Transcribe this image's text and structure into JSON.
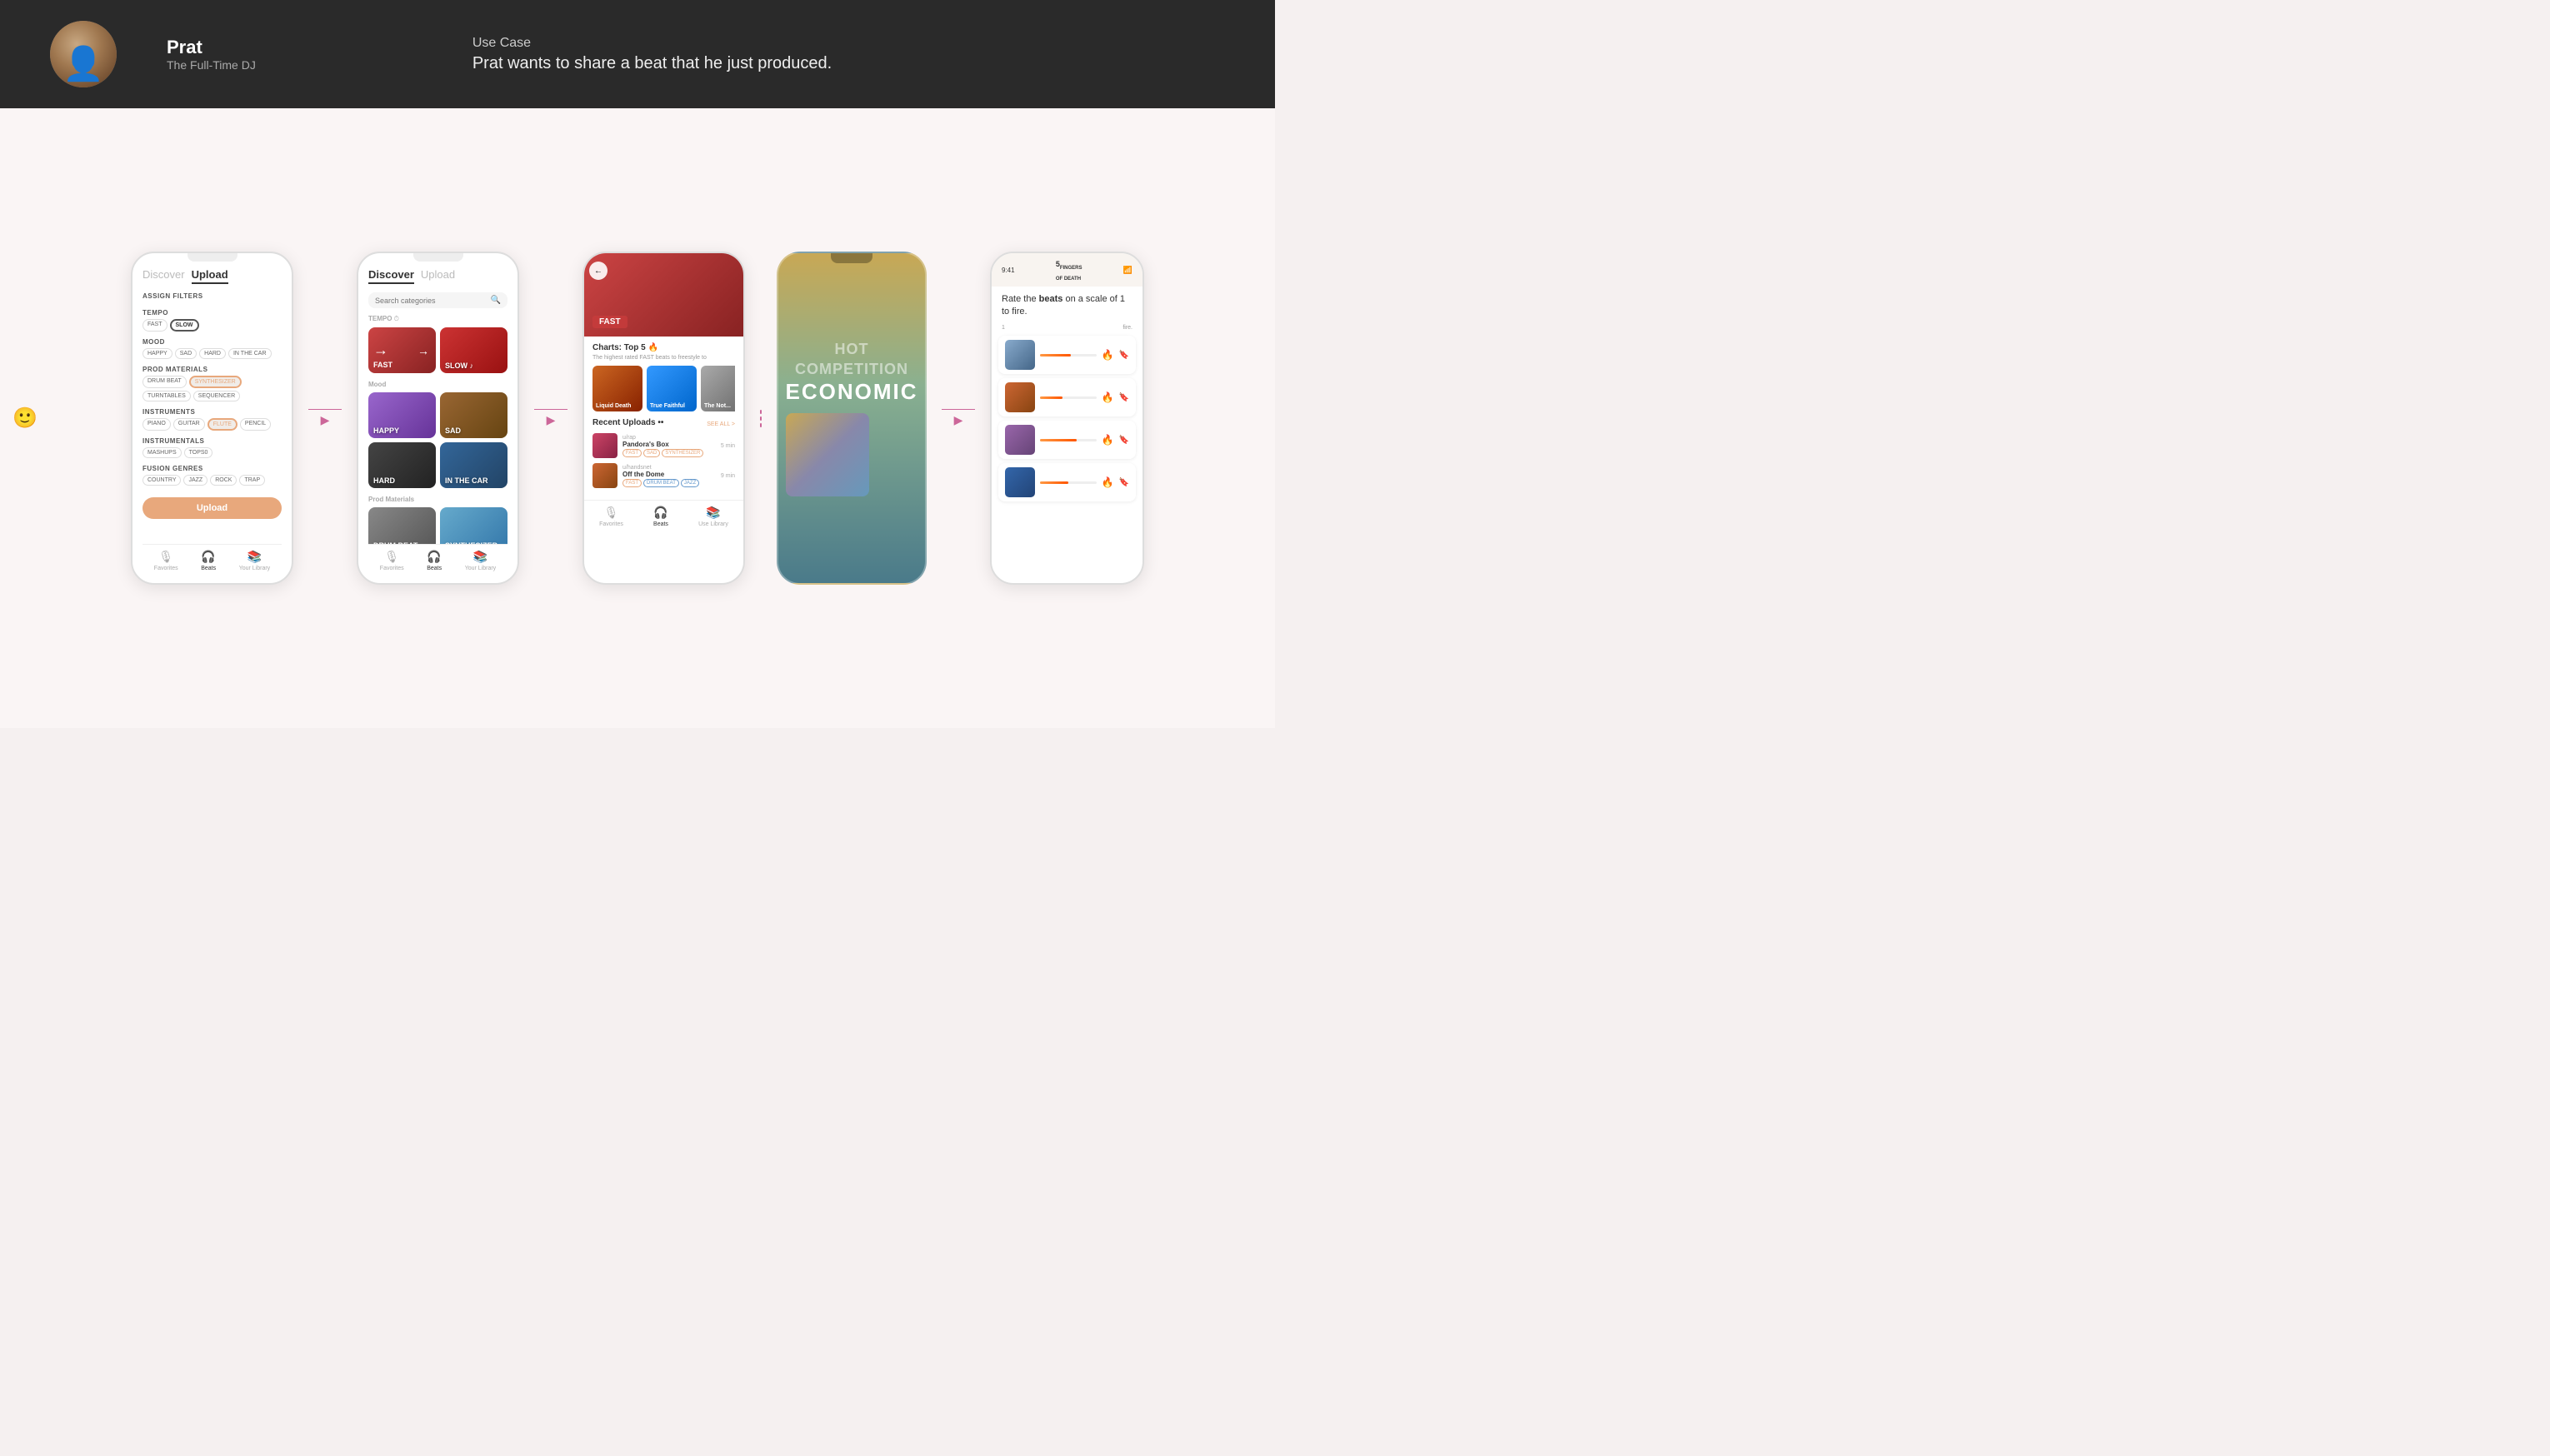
{
  "header": {
    "user_name": "Prat",
    "user_title": "The Full-Time DJ",
    "use_case_label": "Use Case",
    "use_case_desc": "Prat wants to share a beat that he just produced."
  },
  "phone1": {
    "tab_discover": "Discover",
    "tab_upload": "Upload",
    "section_filters": "ASSIGN FILTERS",
    "tempo_label": "Tempo",
    "tempo_tags": [
      "FAST",
      "SLOW"
    ],
    "mood_label": "Mood",
    "mood_tags": [
      "HAPPY",
      "SAD",
      "HARD",
      "IN THE CAR"
    ],
    "prod_label": "Prod Materials",
    "prod_tags": [
      "DRUM BEAT",
      "SYNTHESIZER"
    ],
    "prod_tags2": [
      "TURNTABLES",
      "SEQUENCER"
    ],
    "instruments_label": "Instruments",
    "instruments_tags": [
      "PIANO",
      "GUITAR",
      "FLUTE",
      "PENCIL"
    ],
    "instrumentals_label": "Instrumentals",
    "instrumentals_tags": [
      "MASHUPS",
      "TOPS0"
    ],
    "fusion_label": "Fusion Genres",
    "fusion_tags": [
      "COUNTRY",
      "JAZZ",
      "ROCK",
      "TRAP"
    ],
    "upload_btn": "Upload",
    "tab_favorites": "Favorites",
    "tab_beats": "Beats",
    "tab_library": "Your Library"
  },
  "phone2": {
    "tab_discover": "Discover",
    "tab_upload": "Upload",
    "search_placeholder": "Search categories",
    "tempo_label": "TEMPO",
    "mood_label": "Mood",
    "prod_label": "Prod Materials",
    "categories": [
      {
        "label": "FAST",
        "style": "fast"
      },
      {
        "label": "SLOW ♪",
        "style": "slow"
      },
      {
        "label": "HAPPY",
        "style": "happy"
      },
      {
        "label": "SAD",
        "style": "sad"
      },
      {
        "label": "HARD",
        "style": "hard"
      },
      {
        "label": "IN THE CAR",
        "style": "inthecar"
      },
      {
        "label": "DRUM BEAT",
        "style": "drumbeat"
      },
      {
        "label": "SYNTHESIZER",
        "style": "synth"
      }
    ],
    "tab_favorites": "Favorites",
    "tab_beats": "Beats",
    "tab_library": "Your Library"
  },
  "phone3": {
    "hero_label": "FAST",
    "charts_title": "Charts: Top 5 🔥",
    "charts_subtitle": "The highest rated FAST beats to freestyle to",
    "mood_cards": [
      {
        "label": "Liquid Death",
        "style": "liq"
      },
      {
        "label": "True Faithful",
        "style": "tru"
      },
      {
        "label": "The Not...",
        "style": "not"
      }
    ],
    "recent_title": "Recent Uploads ••",
    "see_all": "SEE ALL >",
    "uploads": [
      {
        "user": "u/rap",
        "title": "Pandora's Box",
        "tags": [
          "FAST",
          "SAD",
          "SYNTHESIZER"
        ],
        "time": "5 min"
      },
      {
        "user": "u/handsnet",
        "title": "Off the Dome",
        "tags": [
          "FAST",
          "DRUM BEAT",
          "JAZZ"
        ],
        "time": "9 min"
      }
    ],
    "tab_favorites": "Favorites",
    "tab_beats": "Beats",
    "tab_library": "Use Library"
  },
  "phone4": {
    "hot_text": "HOT",
    "competition_text": "COMPETITION",
    "economic_text": "ECONOMIC"
  },
  "phone5": {
    "status_bar": "9:41",
    "logo": "5 FINGERS OF DEATH",
    "rate_text": "Rate the beats on a scale of 1 to fire.",
    "scale_low": "1",
    "scale_high": "fire.",
    "items": [
      {
        "fill": 55
      },
      {
        "fill": 40
      },
      {
        "fill": 65
      },
      {
        "fill": 50
      }
    ]
  }
}
